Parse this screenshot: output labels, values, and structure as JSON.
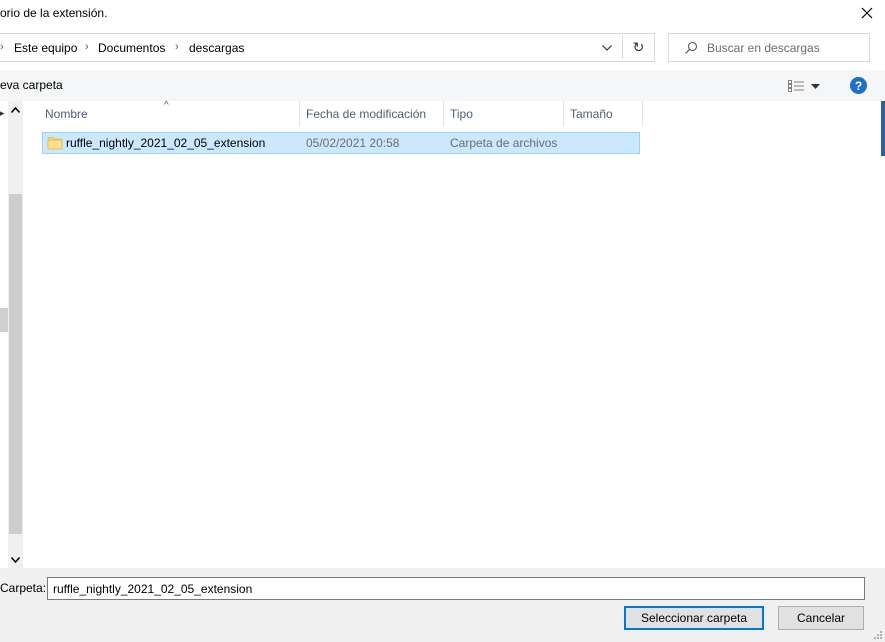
{
  "window": {
    "title": "orio de la extensión."
  },
  "address": {
    "crumbs": [
      "Este equipo",
      "Documentos",
      "descargas"
    ]
  },
  "search": {
    "placeholder": "Buscar en descargas"
  },
  "toolbar": {
    "new_folder_label": "eva carpeta",
    "help_label": "?"
  },
  "table": {
    "columns": [
      "Nombre",
      "Fecha de modificación",
      "Tipo",
      "Tamaño"
    ],
    "rows": [
      {
        "name": "ruffle_nightly_2021_02_05_extension",
        "modified": "05/02/2021 20:58",
        "type": "Carpeta de archivos",
        "size": "",
        "selected": true
      }
    ]
  },
  "footer": {
    "folder_label": "Carpeta:",
    "folder_value": "ruffle_nightly_2021_02_05_extension",
    "select_button": "Seleccionar carpeta",
    "cancel_button": "Cancelar"
  },
  "colors": {
    "selection_bg": "#cce8ff",
    "selection_border": "#99d1ff",
    "accent": "#0078d7",
    "help_icon": "#1f6fd1"
  },
  "icons": {
    "close": "close-icon",
    "dropdown": "chevron-down-icon",
    "refresh": "refresh-icon",
    "search": "search-icon",
    "view": "view-details-icon",
    "help": "help-icon",
    "folder": "folder-icon"
  }
}
